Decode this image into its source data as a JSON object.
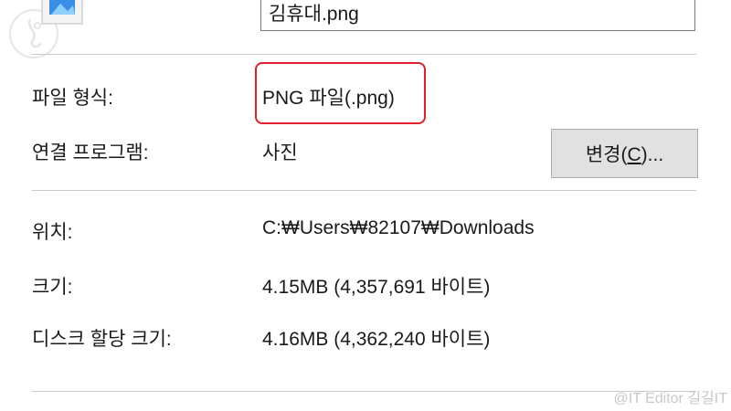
{
  "general": {
    "file_name": "김휴대.png"
  },
  "details": {
    "file_type_label": "파일 형식:",
    "file_type_value": "PNG 파일(.png)",
    "opens_with_label": "연결 프로그램:",
    "opens_with_value": "사진",
    "change_button": {
      "prefix": "변경(",
      "hotkey": "C",
      "suffix": ")..."
    },
    "location_label": "위치:",
    "location_value": "C:₩Users₩82107₩Downloads",
    "size_label": "크기:",
    "size_value": "4.15MB (4,357,691 바이트)",
    "size_on_disk_label": "디스크 할당 크기:",
    "size_on_disk_value": "4.16MB (4,362,240 바이트)"
  },
  "watermark": "@IT Editor 길길IT",
  "colors": {
    "highlight": "#e0202a",
    "separator": "#c9c9c9",
    "button_bg": "#e1e1e1"
  },
  "icons": [
    "brand-logo-icon",
    "image-file-icon"
  ]
}
